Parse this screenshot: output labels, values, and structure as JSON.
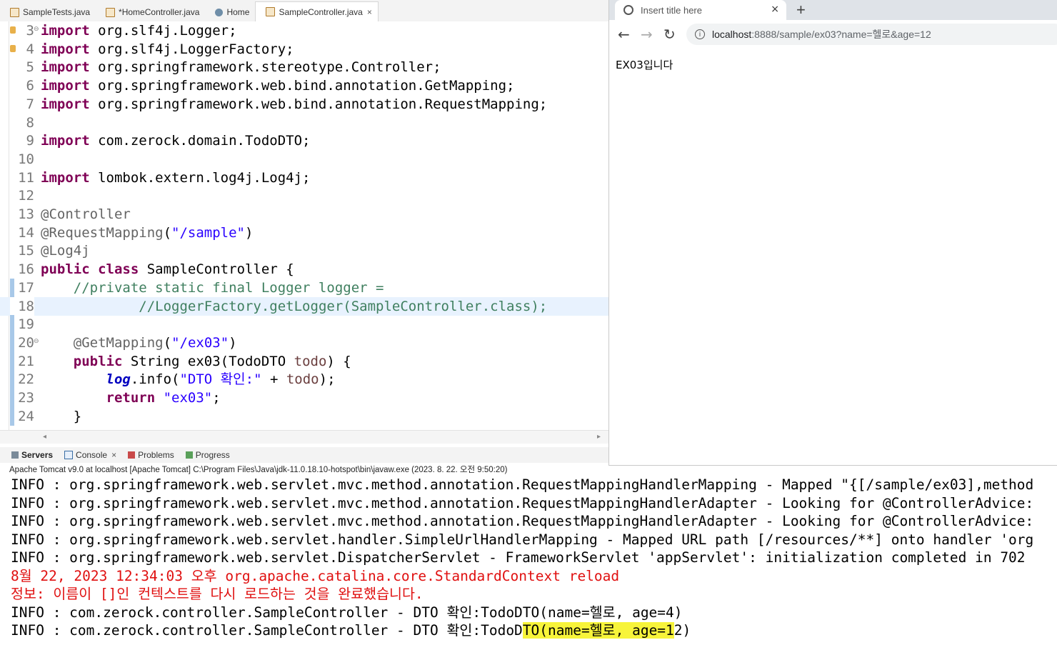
{
  "editor": {
    "tabs": [
      {
        "label": "SampleTests.java",
        "active": false,
        "icon": "java-file-icon"
      },
      {
        "label": "*HomeController.java",
        "active": false,
        "icon": "java-file-icon"
      },
      {
        "label": "Home",
        "active": false,
        "icon": "globe-icon"
      },
      {
        "label": "SampleController.java",
        "active": true,
        "icon": "java-file-icon",
        "close": "×"
      }
    ],
    "lines": [
      {
        "num": "3",
        "text": "import org.slf4j.Logger;"
      },
      {
        "num": "4",
        "text": "import org.slf4j.LoggerFactory;"
      },
      {
        "num": "5",
        "text": "import org.springframework.stereotype.Controller;"
      },
      {
        "num": "6",
        "text": "import org.springframework.web.bind.annotation.GetMapping;"
      },
      {
        "num": "7",
        "text": "import org.springframework.web.bind.annotation.RequestMapping;"
      },
      {
        "num": "8",
        "text": ""
      },
      {
        "num": "9",
        "text": "import com.zerock.domain.TodoDTO;"
      },
      {
        "num": "10",
        "text": ""
      },
      {
        "num": "11",
        "text": "import lombok.extern.log4j.Log4j;"
      },
      {
        "num": "12",
        "text": ""
      },
      {
        "num": "13",
        "text": "@Controller"
      },
      {
        "num": "14",
        "text": "@RequestMapping(\"/sample\")"
      },
      {
        "num": "15",
        "text": "@Log4j"
      },
      {
        "num": "16",
        "text": "public class SampleController {"
      },
      {
        "num": "17",
        "text": "    //private static final Logger logger ="
      },
      {
        "num": "18",
        "text": "            //LoggerFactory.getLogger(SampleController.class);"
      },
      {
        "num": "19",
        "text": ""
      },
      {
        "num": "20",
        "text": "    @GetMapping(\"/ex03\")"
      },
      {
        "num": "21",
        "text": "    public String ex03(TodoDTO todo) {"
      },
      {
        "num": "22",
        "text": "        log.info(\"DTO 확인:\" + todo);"
      },
      {
        "num": "23",
        "text": "        return \"ex03\";"
      },
      {
        "num": "24",
        "text": "    }"
      }
    ]
  },
  "browser": {
    "tab_title": "Insert title here",
    "tab_close": "×",
    "new_tab": "+",
    "url_host": "localhost",
    "url_rest": ":8888/sample/ex03?name=헬로&age=12",
    "body_text": "EX03입니다"
  },
  "panel": {
    "tabs": [
      "Servers",
      "Console",
      "Problems",
      "Progress"
    ],
    "console_header": "Apache Tomcat v9.0  at localhost [Apache Tomcat] C:\\Program Files\\Java\\jdk-11.0.18.10-hotspot\\bin\\javaw.exe  (2023. 8. 22. 오전 9:50:20)",
    "logs": [
      {
        "text": "INFO : org.springframework.web.servlet.mvc.method.annotation.RequestMappingHandlerMapping - Mapped \"{[/sample/ex03],method",
        "color": "black"
      },
      {
        "text": "INFO : org.springframework.web.servlet.mvc.method.annotation.RequestMappingHandlerAdapter - Looking for @ControllerAdvice:",
        "color": "black"
      },
      {
        "text": "INFO : org.springframework.web.servlet.mvc.method.annotation.RequestMappingHandlerAdapter - Looking for @ControllerAdvice:",
        "color": "black"
      },
      {
        "text": "INFO : org.springframework.web.servlet.handler.SimpleUrlHandlerMapping - Mapped URL path [/resources/**] onto handler 'org",
        "color": "black"
      },
      {
        "text": "INFO : org.springframework.web.servlet.DispatcherServlet - FrameworkServlet 'appServlet': initialization completed in 702",
        "color": "black"
      },
      {
        "text": "8월 22, 2023 12:34:03 오후 org.apache.catalina.core.StandardContext reload",
        "color": "red"
      },
      {
        "text": "정보: 이름이 []인 컨텍스트를 다시 로드하는 것을 완료했습니다.",
        "color": "red"
      },
      {
        "text": "INFO : com.zerock.controller.SampleController - DTO 확인:TodoDTO(name=헬로, age=4)",
        "color": "black"
      },
      {
        "text_before": "INFO : com.zerock.controller.SampleController - DTO 확인:TodoD",
        "text_highlight": "TO(name=헬로, age=1",
        "text_after": "2)",
        "color": "black"
      }
    ],
    "highlight_color": "#f7f43a"
  }
}
